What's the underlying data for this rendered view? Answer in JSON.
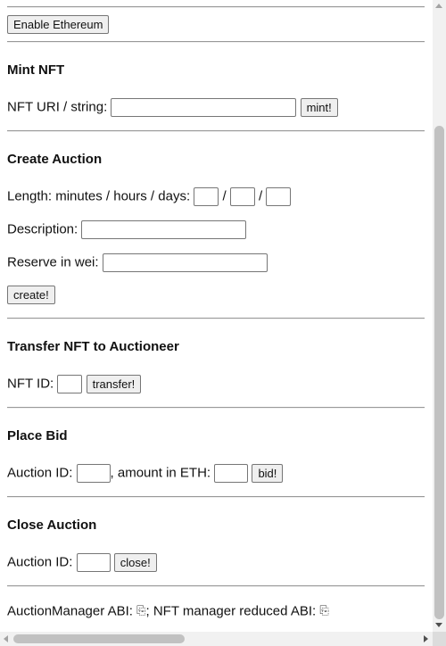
{
  "enable_button": "Enable Ethereum",
  "mint": {
    "heading": "Mint NFT",
    "uri_label": "NFT URI / string:",
    "uri_value": "",
    "button": "mint!"
  },
  "create_auction": {
    "heading": "Create Auction",
    "length_label": "Length: minutes / hours / days:",
    "separator": "/",
    "minutes": "",
    "hours": "",
    "days": "",
    "description_label": "Description:",
    "description_value": "",
    "reserve_label": "Reserve in wei:",
    "reserve_value": "",
    "button": "create!"
  },
  "transfer": {
    "heading": "Transfer NFT to Auctioneer",
    "nft_id_label": "NFT ID:",
    "nft_id_value": "",
    "button": "transfer!"
  },
  "bid": {
    "heading": "Place Bid",
    "auction_id_label": "Auction ID:",
    "auction_id_value": "",
    "amount_label": ", amount in ETH:",
    "amount_value": "",
    "button": "bid!"
  },
  "close": {
    "heading": "Close Auction",
    "auction_id_label": "Auction ID:",
    "auction_id_value": "",
    "button": "close!"
  },
  "abi": {
    "manager_label": "AuctionManager ABI:",
    "separator": ";",
    "nft_label": "NFT manager reduced ABI:",
    "copy_icon": "copy-icon"
  }
}
